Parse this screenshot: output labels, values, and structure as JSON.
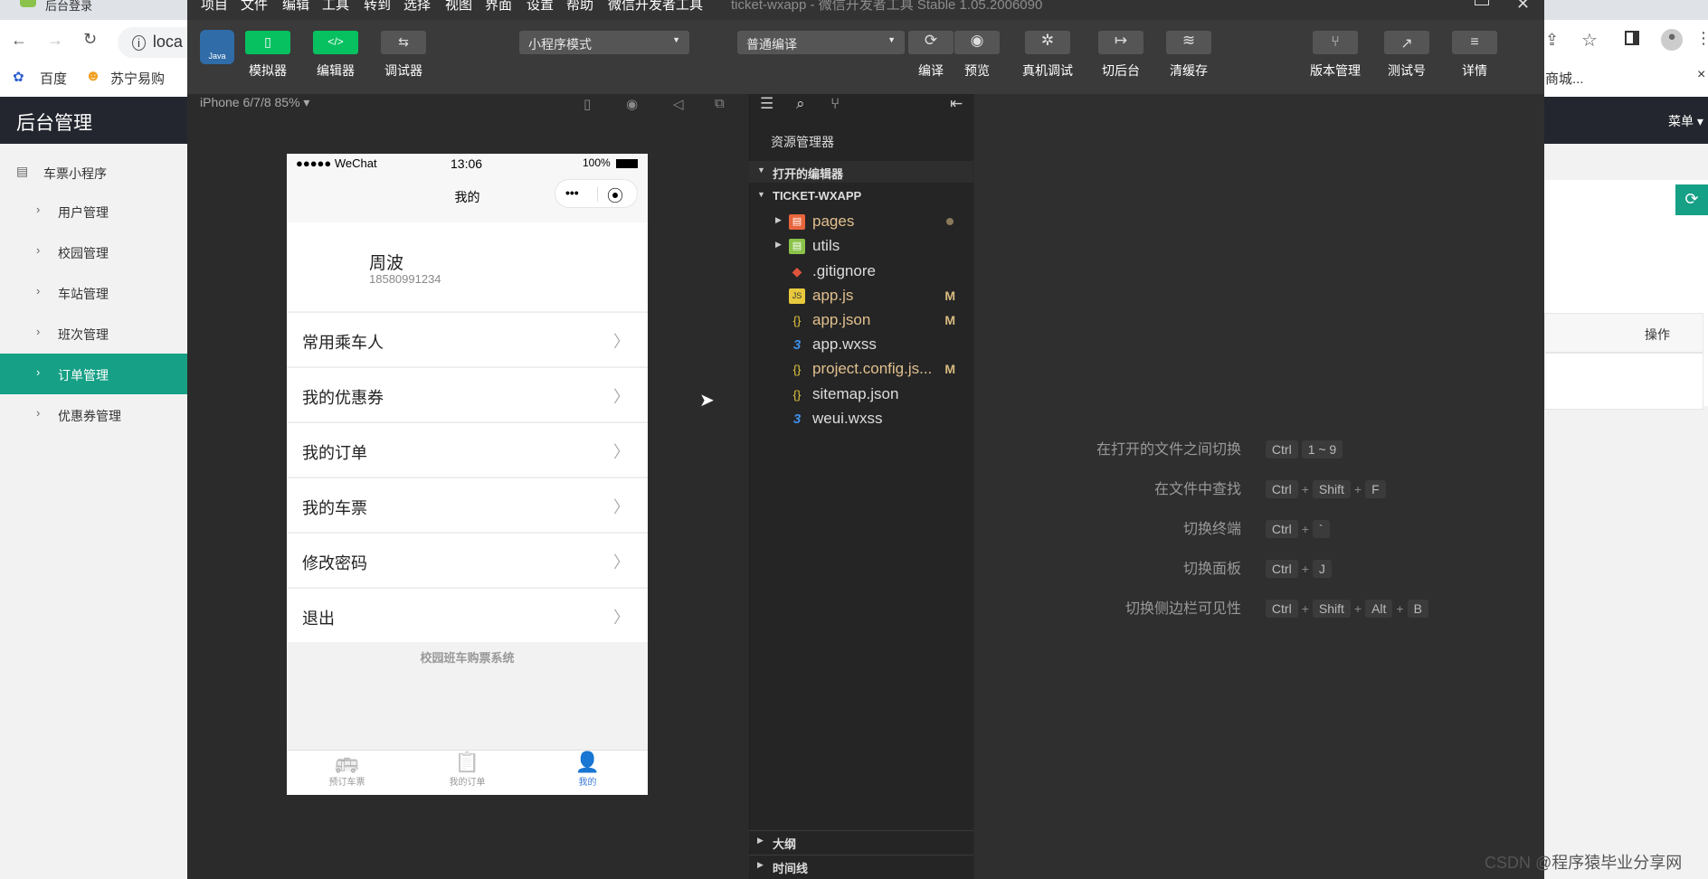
{
  "browser": {
    "tab_title": "后台登录",
    "address": "loca",
    "bookmarks": [
      "百度",
      "苏宁易购"
    ],
    "bookmark_right": "商城...",
    "close_x": "×"
  },
  "admin": {
    "title": "后台管理",
    "menu_right": "菜单",
    "sidebar": [
      {
        "label": "车票小程序"
      },
      {
        "label": "用户管理"
      },
      {
        "label": "校园管理"
      },
      {
        "label": "车站管理"
      },
      {
        "label": "班次管理"
      },
      {
        "label": "订单管理"
      },
      {
        "label": "优惠券管理"
      }
    ],
    "table_op_header": "操作",
    "refresh_icon": "⟳"
  },
  "devtools": {
    "menu": [
      "项目",
      "文件",
      "编辑",
      "工具",
      "转到",
      "选择",
      "视图",
      "界面",
      "设置",
      "帮助",
      "微信开发者工具"
    ],
    "window_title": "ticket-wxapp - 微信开发者工具 Stable 1.05.2006090",
    "logo_text": "Java",
    "toolbar_left": [
      {
        "label": "模拟器",
        "icon": "▯"
      },
      {
        "label": "编辑器",
        "icon": "</>"
      },
      {
        "label": "调试器",
        "icon": "⇆"
      }
    ],
    "mode_select": "小程序模式",
    "compile_select": "普通编译",
    "toolbar_mid": [
      {
        "label": "编译",
        "icon": "⟳"
      },
      {
        "label": "预览",
        "icon": "◉"
      },
      {
        "label": "真机调试",
        "icon": "✲"
      },
      {
        "label": "切后台",
        "icon": "↦"
      },
      {
        "label": "清缓存",
        "icon": "≋"
      }
    ],
    "toolbar_right": [
      {
        "label": "版本管理",
        "icon": "⑂"
      },
      {
        "label": "测试号",
        "icon": "↗"
      },
      {
        "label": "详情",
        "icon": "≡"
      }
    ],
    "device_label": "iPhone 6/7/8 85% ▾"
  },
  "phone": {
    "status_left": "●●●●● WeChat",
    "status_time": "13:06",
    "status_battery": "100%",
    "nav_title": "我的",
    "capsule_more": "•••",
    "capsule_close": "⦿",
    "user_name": "周波",
    "user_phone": "18580991234",
    "menu": [
      "常用乘车人",
      "我的优惠券",
      "我的订单",
      "我的车票",
      "修改密码",
      "退出"
    ],
    "footer": "校园班车购票系统",
    "tabs": [
      {
        "label": "预订车票",
        "icon": "🚌"
      },
      {
        "label": "我的订单",
        "icon": "📋"
      },
      {
        "label": "我的",
        "icon": "👤"
      }
    ]
  },
  "explorer": {
    "title": "资源管理器",
    "open_editors": "打开的编辑器",
    "project": "TICKET-WXAPP",
    "files": [
      {
        "name": "pages",
        "icon": "▤",
        "color": "#e8663d",
        "type": "folder",
        "modified": "",
        "dot": true
      },
      {
        "name": "utils",
        "icon": "▤",
        "color": "#8bc34a",
        "type": "folder",
        "modified": "",
        "dot": false
      },
      {
        "name": ".gitignore",
        "icon": "◆",
        "color": "#e0543d",
        "type": "file",
        "modified": "",
        "dot": false
      },
      {
        "name": "app.js",
        "icon": "JS",
        "color": "#e8c93d",
        "type": "file",
        "modified": "M",
        "dot": false
      },
      {
        "name": "app.json",
        "icon": "{}",
        "color": "#e8c93d",
        "type": "file",
        "modified": "M",
        "dot": false
      },
      {
        "name": "app.wxss",
        "icon": "3",
        "color": "#3d8fe8",
        "type": "file",
        "modified": "",
        "dot": false
      },
      {
        "name": "project.config.js...",
        "icon": "{}",
        "color": "#e8c93d",
        "type": "file",
        "modified": "M",
        "dot": false
      },
      {
        "name": "sitemap.json",
        "icon": "{}",
        "color": "#e8c93d",
        "type": "file",
        "modified": "",
        "dot": false
      },
      {
        "name": "weui.wxss",
        "icon": "3",
        "color": "#3d8fe8",
        "type": "file",
        "modified": "",
        "dot": false
      }
    ],
    "outline": "大纲",
    "timeline": "时间线"
  },
  "shortcuts": [
    {
      "label": "在打开的文件之间切换",
      "keys": [
        "Ctrl",
        "1 ~ 9"
      ]
    },
    {
      "label": "在文件中查找",
      "keys": [
        "Ctrl",
        "Shift",
        "F"
      ]
    },
    {
      "label": "切换终端",
      "keys": [
        "Ctrl",
        "`"
      ]
    },
    {
      "label": "切换面板",
      "keys": [
        "Ctrl",
        "J"
      ]
    },
    {
      "label": "切换侧边栏可见性",
      "keys": [
        "Ctrl",
        "Shift",
        "Alt",
        "B"
      ]
    }
  ],
  "watermark": "CSDN @程序猿毕业分享网"
}
